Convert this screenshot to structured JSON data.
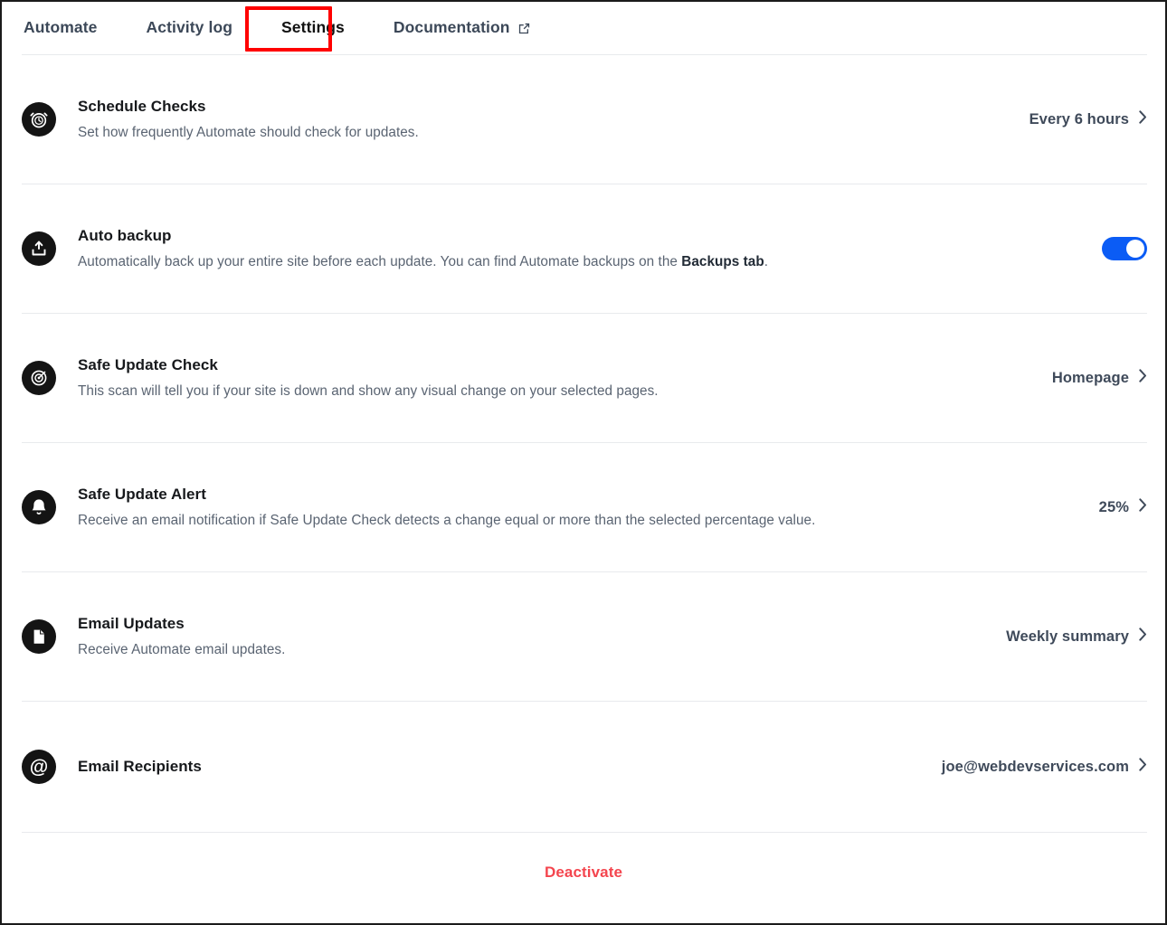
{
  "tabs": [
    {
      "label": "Automate",
      "active": false,
      "external": false
    },
    {
      "label": "Activity log",
      "active": false,
      "external": false
    },
    {
      "label": "Settings",
      "active": true,
      "external": false
    },
    {
      "label": "Documentation",
      "active": false,
      "external": true
    }
  ],
  "annotation": {
    "target": "Settings",
    "color": "#ff0000"
  },
  "settings": [
    {
      "icon": "alarm-clock-icon",
      "title": "Schedule Checks",
      "description": "Set how frequently Automate should check for updates.",
      "control": "value",
      "value": "Every 6 hours"
    },
    {
      "icon": "backup-upload-icon",
      "title": "Auto backup",
      "description_prefix": "Automatically back up your entire site before each update. You can find Automate backups on the ",
      "description_link": "Backups tab",
      "description_suffix": ".",
      "control": "toggle",
      "toggle_on": true,
      "toggle_color": "#0b5cf5"
    },
    {
      "icon": "target-bullseye-icon",
      "title": "Safe Update Check",
      "description": "This scan will tell you if your site is down and show any visual change on your selected pages.",
      "control": "value",
      "value": "Homepage"
    },
    {
      "icon": "bell-icon",
      "title": "Safe Update Alert",
      "description": "Receive an email notification if Safe Update Check detects a change equal or more than the selected percentage value.",
      "control": "value",
      "value": "25%"
    },
    {
      "icon": "document-page-icon",
      "title": "Email Updates",
      "description": "Receive Automate email updates.",
      "control": "value",
      "value": "Weekly summary"
    },
    {
      "icon": "at-sign-icon",
      "title": "Email Recipients",
      "description": "",
      "control": "value",
      "value": "joe@webdevservices.com"
    }
  ],
  "footer": {
    "deactivate_label": "Deactivate",
    "deactivate_color": "#f4454e"
  }
}
